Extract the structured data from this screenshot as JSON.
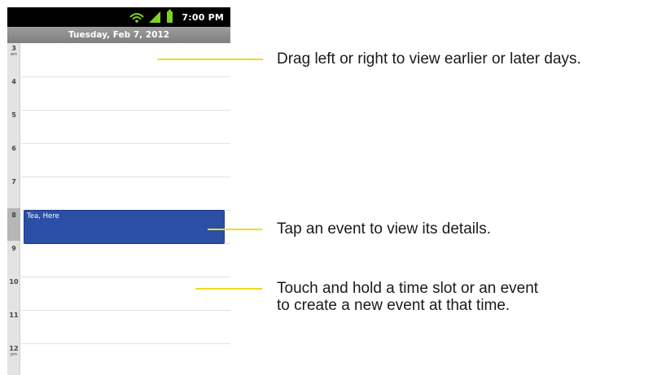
{
  "status_bar": {
    "time": "7:00 PM",
    "icons": [
      "wifi-icon",
      "signal-icon",
      "battery-icon"
    ],
    "battery_color": "#7ed321"
  },
  "date_header": "Tuesday, Feb 7, 2012",
  "hours": [
    {
      "label": "3",
      "suffix": "am"
    },
    {
      "label": "4",
      "suffix": ""
    },
    {
      "label": "5",
      "suffix": ""
    },
    {
      "label": "6",
      "suffix": ""
    },
    {
      "label": "7",
      "suffix": ""
    },
    {
      "label": "8",
      "suffix": ""
    },
    {
      "label": "9",
      "suffix": ""
    },
    {
      "label": "10",
      "suffix": ""
    },
    {
      "label": "11",
      "suffix": ""
    },
    {
      "label": "12",
      "suffix": "pm"
    }
  ],
  "event": {
    "title": "Tea, Here",
    "color": "#2a4fa5"
  },
  "callouts": [
    {
      "text": "Drag left or right to view earlier or later days."
    },
    {
      "text": "Tap an event to view its details."
    },
    {
      "text": "Touch and hold a time slot or an event\nto create a new event at that time."
    }
  ],
  "callout_line_color": "#f0dc1c"
}
